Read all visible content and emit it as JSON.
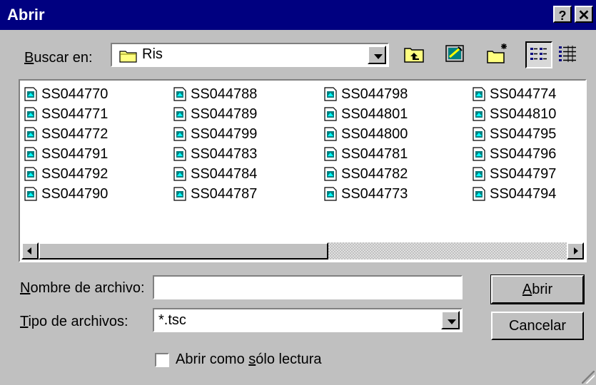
{
  "window": {
    "title": "Abrir",
    "help_glyph": "?",
    "close_glyph": "✕"
  },
  "lookin": {
    "label_u": "B",
    "label_rest": "uscar en:",
    "value": "Ris",
    "icon": "folder-icon"
  },
  "toolbar": {
    "icons": [
      "up-one-level-icon",
      "desktop-icon",
      "new-folder-icon",
      "list-view-icon",
      "details-view-icon"
    ]
  },
  "files": [
    [
      "SS044770",
      "SS044788",
      "SS044798",
      "SS044774"
    ],
    [
      "SS044771",
      "SS044789",
      "SS044801",
      "SS044810"
    ],
    [
      "SS044772",
      "SS044799",
      "SS044800",
      "SS044795"
    ],
    [
      "SS044791",
      "SS044783",
      "SS044781",
      "SS044796"
    ],
    [
      "SS044792",
      "SS044784",
      "SS044782",
      "SS044797"
    ],
    [
      "SS044790",
      "SS044787",
      "SS044773",
      "SS044794"
    ]
  ],
  "filename": {
    "label_u": "N",
    "label_rest": "ombre de archivo:",
    "value": ""
  },
  "filetype": {
    "label_u": "T",
    "label_rest": "ipo de archivos:",
    "value": "*.tsc"
  },
  "readonly": {
    "label_pre": "Abrir como ",
    "label_u": "s",
    "label_rest": "ólo lectura",
    "checked": false
  },
  "buttons": {
    "open_u": "A",
    "open_rest": "brir",
    "cancel": "Cancelar"
  },
  "colors": {
    "titlebar": "#000080",
    "face": "#c0c0c0"
  }
}
